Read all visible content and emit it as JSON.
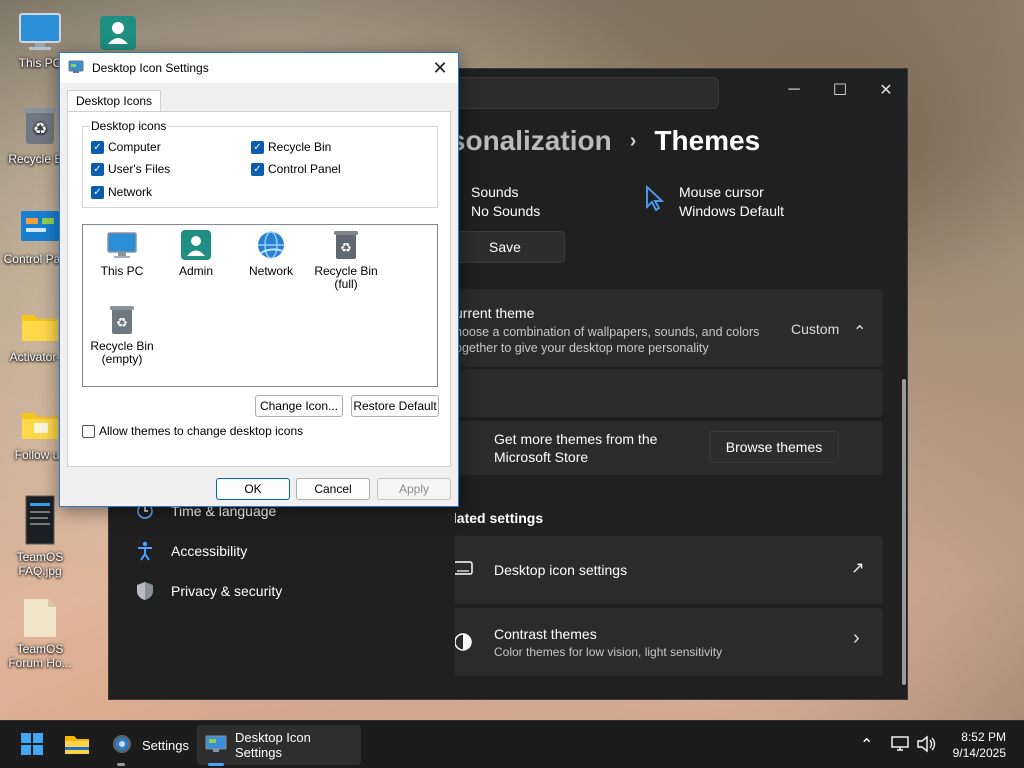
{
  "desktop": {
    "icons": [
      {
        "label": "This PC",
        "icon": "monitor-icon"
      },
      {
        "label": "Recycle Bin",
        "icon": "recycle-bin-icon"
      },
      {
        "label": "Control Panel",
        "icon": "control-panel-icon"
      },
      {
        "label": "Activator-...",
        "icon": "folder-icon"
      },
      {
        "label": "Follow us",
        "icon": "folder-icon"
      },
      {
        "label": "TeamOS FAQ.jpg",
        "icon": "image-file-icon"
      },
      {
        "label": "TeamOS Forum Ho...",
        "icon": "document-icon"
      },
      {
        "label": "",
        "icon": "user-folder-icon"
      }
    ]
  },
  "settings": {
    "breadcrumb_parent": "rsonalization",
    "breadcrumb_sep": "›",
    "breadcrumb_current": "Themes",
    "window_controls": {
      "minimize": "─",
      "maximize": "☐",
      "close": "✕"
    },
    "sounds": {
      "label": "Sounds",
      "value": "No Sounds"
    },
    "mouse": {
      "label": "Mouse cursor",
      "value": "Windows Default"
    },
    "save_label": "Save",
    "current_theme": {
      "title": "urrent theme",
      "desc_line1": "hoose a combination of wallpapers, sounds, and colors",
      "desc_line2": "ogether to give your desktop more personality",
      "value": "Custom",
      "chevron": "⌃"
    },
    "store": {
      "line1": "Get more themes from the",
      "line2": "Microsoft Store",
      "button": "Browse themes"
    },
    "related_heading": "Related settings",
    "desktop_icon_settings": {
      "label": "Desktop icon settings",
      "action_icon": "↗"
    },
    "contrast": {
      "title": "Contrast themes",
      "subtitle": "Color themes for low vision, light sensitivity",
      "chevron": "›"
    },
    "nav": [
      {
        "label": "Time & language",
        "icon": "clock-globe-icon"
      },
      {
        "label": "Accessibility",
        "icon": "accessibility-icon"
      },
      {
        "label": "Privacy & security",
        "icon": "shield-icon"
      }
    ]
  },
  "dialog": {
    "title": "Desktop Icon Settings",
    "tab": "Desktop Icons",
    "group_label": "Desktop icons",
    "checkboxes": [
      {
        "label": "Computer",
        "checked": true
      },
      {
        "label": "Recycle Bin",
        "checked": true
      },
      {
        "label": "User's Files",
        "checked": true
      },
      {
        "label": "Control Panel",
        "checked": true
      },
      {
        "label": "Network",
        "checked": true
      }
    ],
    "check_mark": "✓",
    "icon_list": [
      {
        "line1": "This PC",
        "line2": "",
        "icon": "monitor-icon"
      },
      {
        "line1": "Admin",
        "line2": "",
        "icon": "user-folder-icon"
      },
      {
        "line1": "Network",
        "line2": "",
        "icon": "network-globe-icon"
      },
      {
        "line1": "Recycle Bin",
        "line2": "(full)",
        "icon": "recycle-bin-full-icon"
      },
      {
        "line1": "Recycle Bin",
        "line2": "(empty)",
        "icon": "recycle-bin-empty-icon"
      }
    ],
    "change_icon": "Change Icon...",
    "restore_default": "Restore Default",
    "allow_themes": {
      "label": "Allow themes to change desktop icons",
      "checked": false
    },
    "ok": "OK",
    "cancel": "Cancel",
    "apply": "Apply",
    "close": "✕"
  },
  "taskbar": {
    "settings_label": "Settings",
    "dialog_label": "Desktop Icon Settings",
    "tray_chevron": "⌃",
    "time": "8:52 PM",
    "date": "9/14/2025"
  },
  "colors": {
    "accent": "#0067c0",
    "settings_bg": "#202020",
    "card_bg": "#2b2b2b"
  }
}
